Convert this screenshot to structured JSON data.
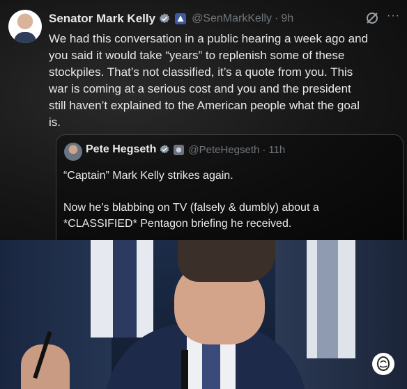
{
  "tweet": {
    "author_name": "Senator Mark Kelly",
    "handle": "@SenMarkKelly",
    "separator": "·",
    "time": "9h",
    "more": "···",
    "text": "We had this conversation in a public hearing a week ago and\nyou said it would take “years” to replenish some of these\nstockpiles. That’s not classified, it’s a quote from you. This\nwar is coming at a serious cost and you and the president\nstill haven’t explained to the American people what the goal\nis."
  },
  "quoted_tweet": {
    "author_name": "Pete Hegseth",
    "handle": "@PeteHegseth",
    "separator": "·",
    "time": "11h",
    "text": "“Captain” Mark Kelly strikes again.\n\nNow he’s blabbing on TV (falsely & dumbly) about a\n*CLASSIFIED* Pentagon briefing he received.",
    "ellipsis": "..."
  },
  "icons": {
    "verified": "verified-badge-icon",
    "government": "government-affiliation-icon",
    "grok": "grok-icon",
    "more": "more-options-icon",
    "watermark": "rose-icon"
  },
  "colors": {
    "verified_blue": "#1d9bf0",
    "government_badge": "#3b5b9c",
    "text_primary": "#e7e9ea",
    "text_secondary": "#71767b"
  }
}
